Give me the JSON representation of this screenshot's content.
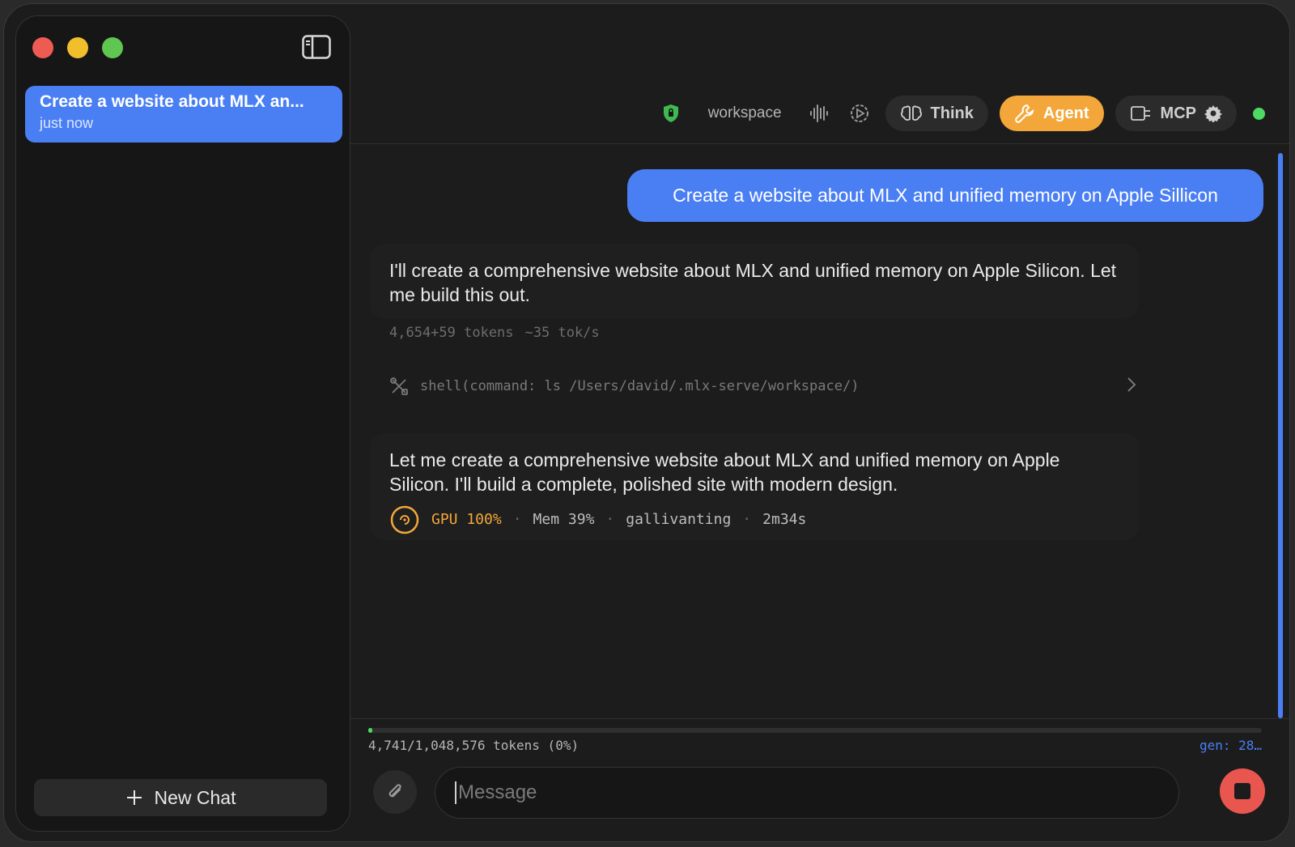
{
  "sidebar": {
    "chats": [
      {
        "title": "Create a website about MLX an...",
        "time": "just now"
      }
    ],
    "new_chat_label": "New Chat"
  },
  "toolbar": {
    "workspace_label": "workspace",
    "think_label": "Think",
    "agent_label": "Agent",
    "mcp_label": "MCP"
  },
  "conversation": {
    "user_message": "Create a website about MLX and unified memory on Apple Sillicon",
    "assistant_message_1": "I'll create a comprehensive website about MLX and unified memory on Apple Silicon. Let me build this out.",
    "meta_tokens": "4,654+59 tokens",
    "meta_speed": "~35 tok/s",
    "tool_call": "shell(command: ls /Users/david/.mlx-serve/workspace/)",
    "assistant_message_2": "Let me create a comprehensive website about MLX and unified memory on Apple Silicon. I'll build a complete, polished site with modern design.",
    "status": {
      "gpu": "GPU 100%",
      "mem": "Mem 39%",
      "activity": "gallivanting",
      "elapsed": "2m34s",
      "separator": "·"
    }
  },
  "footer": {
    "token_usage": "4,741/1,048,576 tokens (0%)",
    "context_fraction": 0.0045,
    "gen_label": "gen: 28…",
    "message_placeholder": "Message"
  },
  "colors": {
    "accent": "#4a7ff4",
    "agent": "#f3a73a",
    "stop": "#e9564f",
    "online": "#4cd964"
  }
}
